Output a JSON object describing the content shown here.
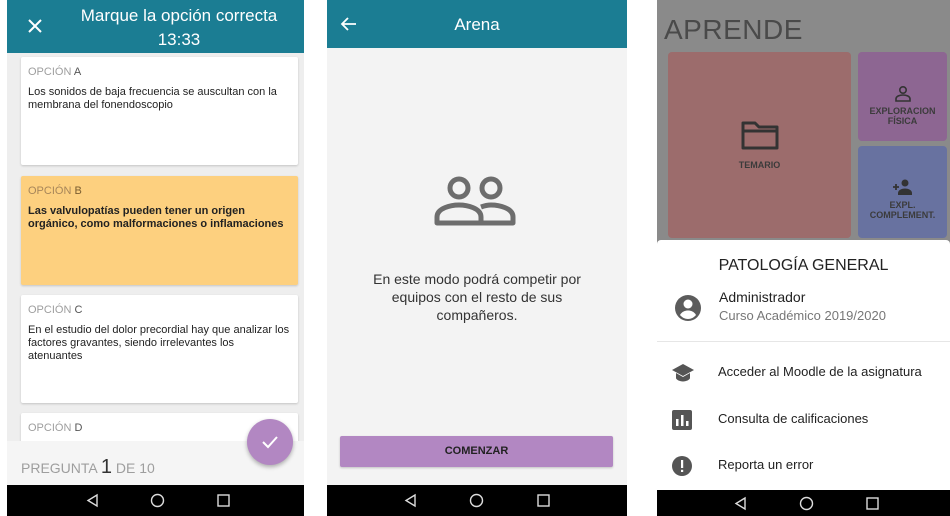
{
  "quiz": {
    "title": "Marque la opción correcta",
    "timer": "13:33",
    "option_word": "OPCIÓN",
    "options": [
      {
        "letter": "A",
        "text": "Los sonidos de baja frecuencia se auscultan con la membrana del fonendoscopio"
      },
      {
        "letter": "B",
        "text": "Las valvulopatías pueden tener un origen orgánico, como malformaciones o inflamaciones"
      },
      {
        "letter": "C",
        "text": "En el estudio del dolor precordial hay que analizar los factores gravantes, siendo irrelevantes los atenuantes"
      },
      {
        "letter": "D",
        "text": ""
      }
    ],
    "selected_letter": "B",
    "question_label": "PREGUNTA",
    "question_number": "1",
    "question_of": "DE 10",
    "colors": {
      "header": "#1b7d93",
      "selected": "#fdd07f",
      "fab": "#b287c2"
    }
  },
  "arena": {
    "title": "Arena",
    "description": "En este modo podrá competir por equipos con el resto de sus compañeros.",
    "start_label": "COMENZAR"
  },
  "menu": {
    "heading": "APRENDE",
    "tiles": {
      "temario": "TEMARIO",
      "exploracion": "EXPLORACION FÍSICA",
      "complementaria": "EXPL. COMPLEMENT."
    },
    "sheet": {
      "title": "PATOLOGÍA GENERAL",
      "user": "Administrador",
      "course": "Curso Académico 2019/2020",
      "items": [
        {
          "label": "Acceder al Moodle de la asignatura",
          "icon": "graduation-cap-icon"
        },
        {
          "label": "Consulta de calificaciones",
          "icon": "bar-chart-icon"
        },
        {
          "label": "Reporta un error",
          "icon": "alert-icon"
        }
      ]
    }
  }
}
